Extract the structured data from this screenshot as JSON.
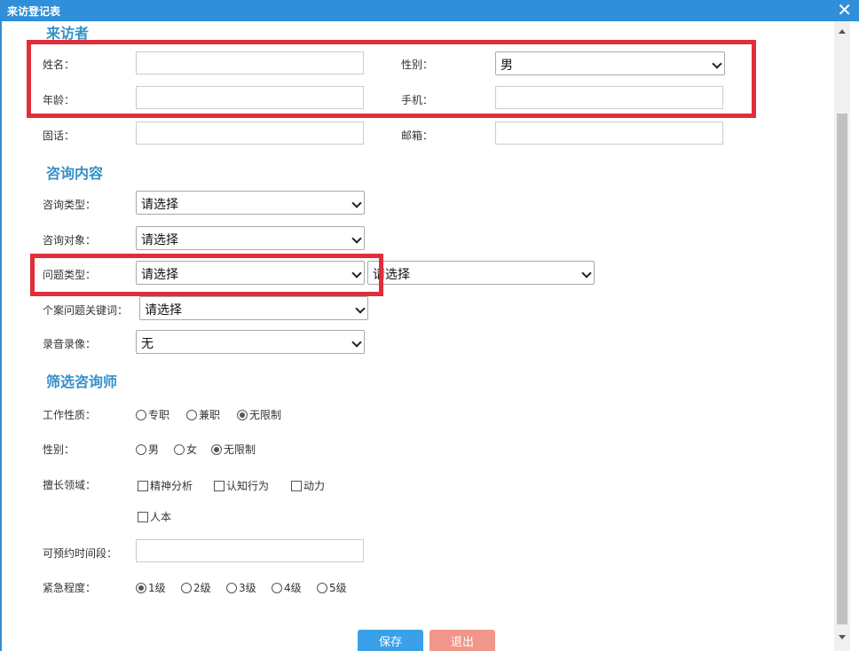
{
  "window": {
    "title": "来访登记表",
    "close_glyph": "✕"
  },
  "sections": {
    "visitor": "来访者",
    "consult": "咨询内容",
    "filter": "筛选咨询师"
  },
  "visitor": {
    "name_label": "姓名：",
    "gender_label": "性别：",
    "gender_value": "男",
    "age_label": "年龄：",
    "mobile_label": "手机：",
    "phone_label": "固话：",
    "email_label": "邮箱："
  },
  "consult": {
    "type_label": "咨询类型：",
    "type_value": "请选择",
    "object_label": "咨询对象：",
    "object_value": "请选择",
    "issue_label": "问题类型：",
    "issue_value": "请选择",
    "issue_sub_value": "请选择",
    "keyword_label": "个案问题关键词：",
    "keyword_value": "请选择",
    "record_label": "录音录像：",
    "record_value": "无"
  },
  "filter": {
    "work_label": "工作性质：",
    "work_options": [
      "专职",
      "兼职",
      "无限制"
    ],
    "work_selected": "无限制",
    "gender_label": "性别：",
    "gender_options": [
      "男",
      "女",
      "无限制"
    ],
    "gender_selected": "无限制",
    "field_label": "擅长领域：",
    "field_options": [
      "精神分析",
      "认知行为",
      "动力",
      "人本"
    ],
    "time_label": "可预约时间段：",
    "urgency_label": "紧急程度：",
    "urgency_options": [
      "1级",
      "2级",
      "3级",
      "4级",
      "5级"
    ],
    "urgency_selected": "1级"
  },
  "buttons": {
    "save": "保存",
    "exit": "退出"
  },
  "colors": {
    "accent": "#2f8fd8",
    "section": "#3590c9",
    "highlight": "#e02e3a",
    "save": "#3aa0e8",
    "exit": "#f0968a"
  }
}
